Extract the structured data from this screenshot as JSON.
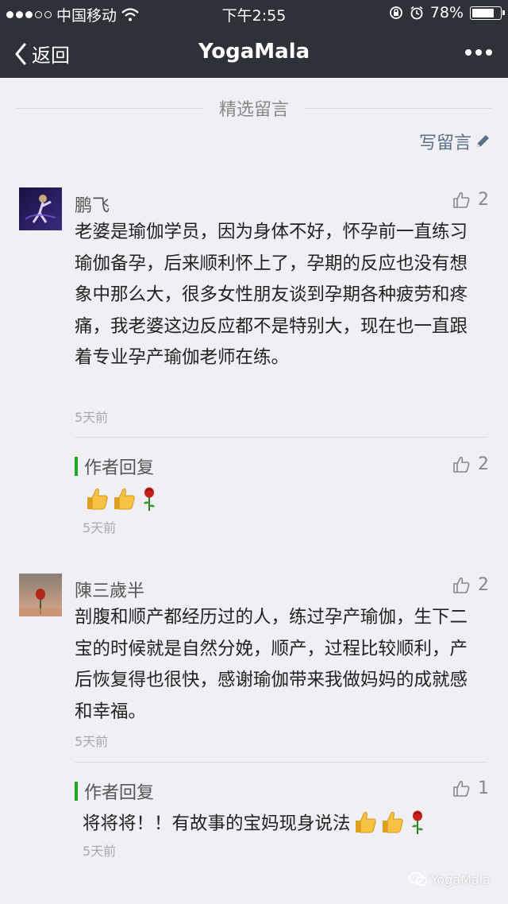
{
  "status_bar": {
    "carrier": "中国移动",
    "time": "下午2:55",
    "battery": "78%",
    "battery_level": 0.78
  },
  "nav": {
    "back_label": "返回",
    "title": "YogaMala"
  },
  "section_title": "精选留言",
  "write_label": "写留言",
  "comments": [
    {
      "name": "鹏飞",
      "likes": "2",
      "text": "老婆是瑜伽学员，因为身体不好，怀孕前一直练习瑜伽备孕，后来顺利怀上了，孕期的反应也没有想象中那么大，很多女性朋友谈到孕期各种疲劳和疼痛，我老婆这边反应都不是特别大，现在也一直跟着专业孕产瑜伽老师在练。",
      "time": "5天前",
      "reply": {
        "label": "作者回复",
        "likes": "2",
        "text": "",
        "emojis": [
          "thumbs-up",
          "thumbs-up",
          "rose"
        ],
        "time": "5天前"
      }
    },
    {
      "name": "陳三歲半",
      "likes": "2",
      "text": "剖腹和顺产都经历过的人，练过孕产瑜伽，生下二宝的时候就是自然分娩，顺产，过程比较顺利，产后恢复得也很快，感谢瑜伽带来我做妈妈的成就感和幸福。",
      "time": "5天前",
      "reply": {
        "label": "作者回复",
        "likes": "1",
        "text": "将将将！！有故事的宝妈现身说法",
        "emojis": [
          "thumbs-up",
          "thumbs-up",
          "rose"
        ],
        "time": "5天前"
      }
    }
  ],
  "watermark": "YogaMala"
}
